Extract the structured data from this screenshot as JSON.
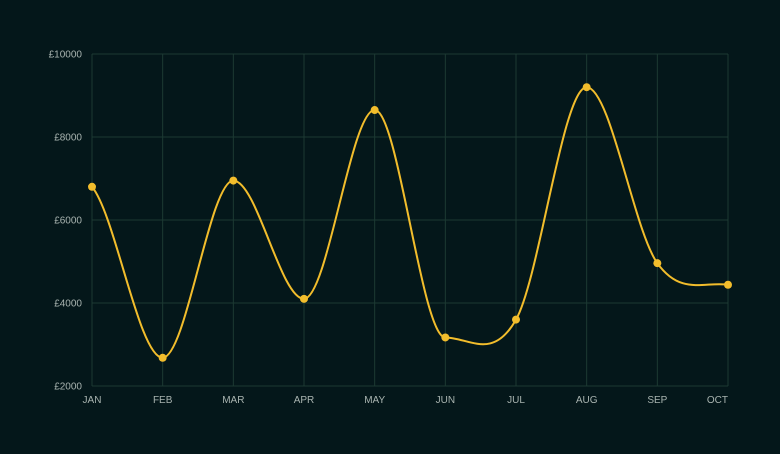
{
  "chart_data": {
    "type": "line",
    "categories": [
      "JAN",
      "FEB",
      "MAR",
      "APR",
      "MAY",
      "JUN",
      "JUL",
      "AUG",
      "SEP",
      "OCT"
    ],
    "series": [
      {
        "values": [
          6800,
          2680,
          6950,
          4100,
          8650,
          3170,
          3600,
          9200,
          4960,
          4440
        ]
      }
    ],
    "ylim": [
      2000,
      10000
    ],
    "yticks": [
      2000,
      4000,
      6000,
      8000,
      10000
    ],
    "ytick_labels": [
      "£2000",
      "£4000",
      "£6000",
      "£8000",
      "£10000"
    ],
    "smooth": true,
    "grid": true,
    "legend": "none",
    "title": "",
    "xlabel": "",
    "ylabel": ""
  },
  "colors": {
    "background": "#04171a",
    "grid": "#1d3a33",
    "line": "#f2bd2c",
    "tick_text": "#a9b4b0"
  }
}
